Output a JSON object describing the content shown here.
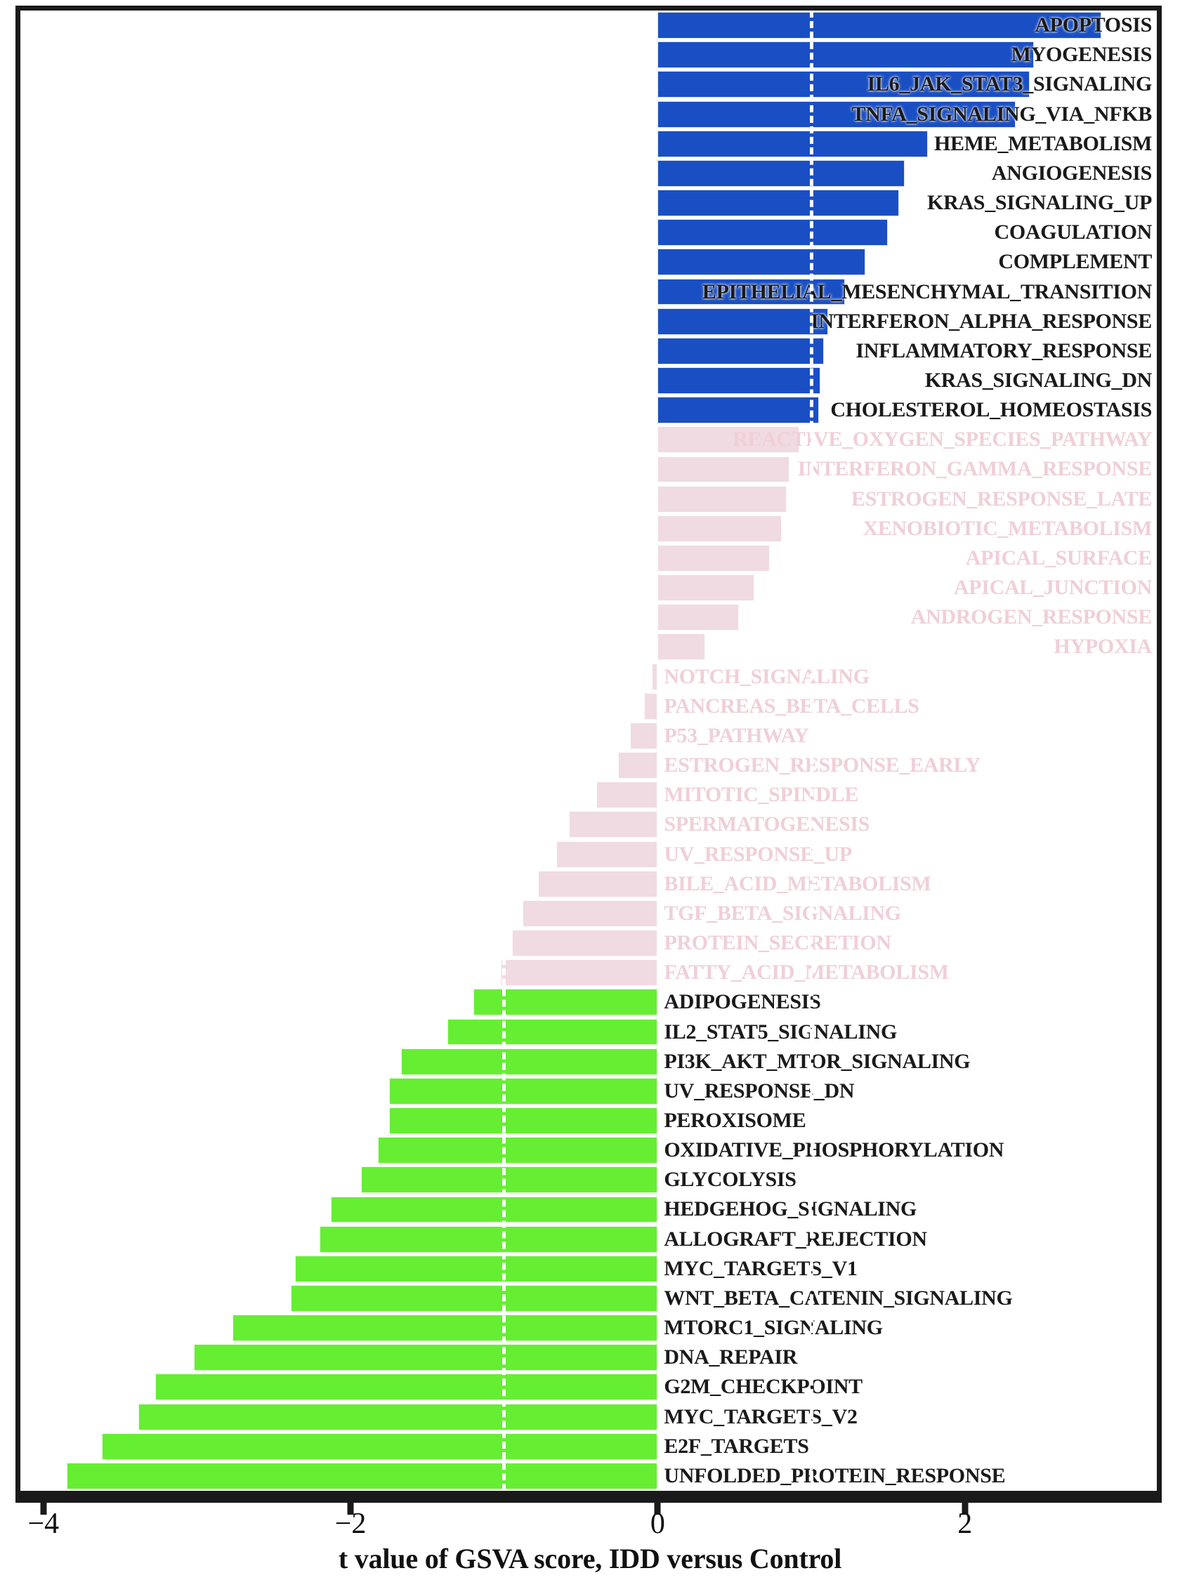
{
  "axis": {
    "x_title": "t value of GSVA score, IDD versus Control",
    "ticks": [
      {
        "value": -4,
        "label": "−4"
      },
      {
        "value": -2,
        "label": "−2"
      },
      {
        "value": 0,
        "label": "0"
      },
      {
        "value": 2,
        "label": "2"
      }
    ],
    "xlim": [
      -4.15,
      3.25
    ],
    "reference_lines": [
      1,
      -1
    ]
  },
  "colors": {
    "positive_significant": "#1a4fc4",
    "nonsignificant": "#f0dbe2",
    "negative_significant": "#66ee33",
    "label_dark": "#1a1a1a",
    "label_faded": "#f0cfd8",
    "frame": "#1a1a1a",
    "reference_line": "#ffffff",
    "background": "#ffffff"
  },
  "chart_data": {
    "type": "bar",
    "orientation": "horizontal",
    "title": "",
    "xlabel": "t value of GSVA score, IDD versus Control",
    "ylabel": "",
    "xlim": [
      -4.15,
      3.25
    ],
    "grid": false,
    "legend": "none",
    "categories": [
      "APOPTOSIS",
      "MYOGENESIS",
      "IL6_JAK_STAT3_SIGNALING",
      "TNFA_SIGNALING_VIA_NFKB",
      "HEME_METABOLISM",
      "ANGIOGENESIS",
      "KRAS_SIGNALING_UP",
      "COAGULATION",
      "COMPLEMENT",
      "EPITHELIAL_MESENCHYMAL_TRANSITION",
      "INTERFERON_ALPHA_RESPONSE",
      "INFLAMMATORY_RESPONSE",
      "KRAS_SIGNALING_DN",
      "CHOLESTEROL_HOMEOSTASIS",
      "REACTIVE_OXYGEN_SPECIES_PATHWAY",
      "INTERFERON_GAMMA_RESPONSE",
      "ESTROGEN_RESPONSE_LATE",
      "XENOBIOTIC_METABOLISM",
      "APICAL_SURFACE",
      "APICAL_JUNCTION",
      "ANDROGEN_RESPONSE",
      "HYPOXIA",
      "NOTCH_SIGNALING",
      "PANCREAS_BETA_CELLS",
      "P53_PATHWAY",
      "ESTROGEN_RESPONSE_EARLY",
      "MITOTIC_SPINDLE",
      "SPERMATOGENESIS",
      "UV_RESPONSE_UP",
      "BILE_ACID_METABOLISM",
      "TGF_BETA_SIGNALING",
      "PROTEIN_SECRETION",
      "FATTY_ACID_METABOLISM",
      "ADIPOGENESIS",
      "IL2_STAT5_SIGNALING",
      "PI3K_AKT_MTOR_SIGNALING",
      "UV_RESPONSE_DN",
      "PEROXISOME",
      "OXIDATIVE_PHOSPHORYLATION",
      "GLYCOLYSIS",
      "HEDGEHOG_SIGNALING",
      "ALLOGRAFT_REJECTION",
      "MYC_TARGETS_V1",
      "WNT_BETA_CATENIN_SIGNALING",
      "MTORC1_SIGNALING",
      "DNA_REPAIR",
      "G2M_CHECKPOINT",
      "MYC_TARGETS_V2",
      "E2F_TARGETS",
      "UNFOLDED_PROTEIN_RESPONSE"
    ],
    "values": [
      2.89,
      2.45,
      2.42,
      2.33,
      1.76,
      1.61,
      1.57,
      1.5,
      1.35,
      1.22,
      1.11,
      1.08,
      1.06,
      1.05,
      0.92,
      0.86,
      0.84,
      0.81,
      0.73,
      0.63,
      0.53,
      0.31,
      -0.04,
      -0.09,
      -0.18,
      -0.26,
      -0.4,
      -0.58,
      -0.66,
      -0.78,
      -0.88,
      -0.95,
      -1.02,
      -1.2,
      -1.37,
      -1.67,
      -1.75,
      -1.75,
      -1.82,
      -1.93,
      -2.13,
      -2.2,
      -2.36,
      -2.39,
      -2.77,
      -3.02,
      -3.27,
      -3.38,
      -3.62,
      -3.85
    ],
    "groups": [
      "positive_significant",
      "positive_significant",
      "positive_significant",
      "positive_significant",
      "positive_significant",
      "positive_significant",
      "positive_significant",
      "positive_significant",
      "positive_significant",
      "positive_significant",
      "positive_significant",
      "positive_significant",
      "positive_significant",
      "positive_significant",
      "nonsignificant",
      "nonsignificant",
      "nonsignificant",
      "nonsignificant",
      "nonsignificant",
      "nonsignificant",
      "nonsignificant",
      "nonsignificant",
      "nonsignificant",
      "nonsignificant",
      "nonsignificant",
      "nonsignificant",
      "nonsignificant",
      "nonsignificant",
      "nonsignificant",
      "nonsignificant",
      "nonsignificant",
      "nonsignificant",
      "nonsignificant",
      "negative_significant",
      "negative_significant",
      "negative_significant",
      "negative_significant",
      "negative_significant",
      "negative_significant",
      "negative_significant",
      "negative_significant",
      "negative_significant",
      "negative_significant",
      "negative_significant",
      "negative_significant",
      "negative_significant",
      "negative_significant",
      "negative_significant",
      "negative_significant",
      "negative_significant"
    ]
  }
}
